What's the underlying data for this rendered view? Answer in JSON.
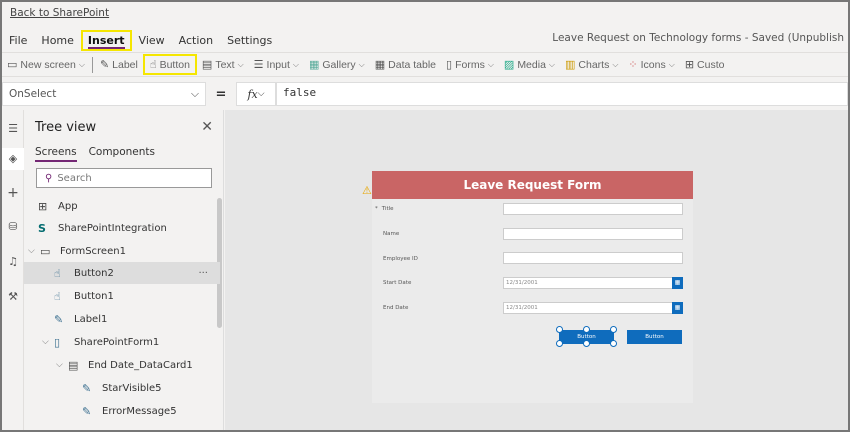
{
  "back_link": "Back to SharePoint",
  "menu": [
    "File",
    "Home",
    "Insert",
    "View",
    "Action",
    "Settings"
  ],
  "active_menu": "Insert",
  "app_title": "Leave Request on Technology forms - Saved (Unpublish",
  "toolbar": [
    {
      "label": "New screen",
      "icon": "new-screen-icon",
      "chevron": "⌵"
    },
    {
      "label": "Label",
      "icon": "label-icon"
    },
    {
      "label": "Button",
      "icon": "button-icon"
    },
    {
      "label": "Text",
      "icon": "text-icon",
      "chevron": "⌵"
    },
    {
      "label": "Input",
      "icon": "input-icon",
      "chevron": "⌵"
    },
    {
      "label": "Gallery",
      "icon": "gallery-icon",
      "chevron": "⌵"
    },
    {
      "label": "Data table",
      "icon": "data-table-icon"
    },
    {
      "label": "Forms",
      "icon": "forms-icon",
      "chevron": "⌵"
    },
    {
      "label": "Media",
      "icon": "media-icon",
      "chevron": "⌵"
    },
    {
      "label": "Charts",
      "icon": "charts-icon",
      "chevron": "⌵"
    },
    {
      "label": "Icons",
      "icon": "icons-icon",
      "chevron": "⌵"
    },
    {
      "label": "Custo",
      "icon": "custom-icon"
    }
  ],
  "formula": {
    "property": "OnSelect",
    "equals": "=",
    "fx": "fx",
    "value": "false"
  },
  "tree": {
    "title": "Tree view",
    "tabs": [
      "Screens",
      "Components"
    ],
    "search_placeholder": "Search",
    "nodes": [
      {
        "label": "App",
        "icon": "app-icon"
      },
      {
        "label": "SharePointIntegration",
        "icon": "sharepoint-icon"
      },
      {
        "label": "FormScreen1",
        "icon": "screen-icon"
      },
      {
        "label": "Button2",
        "icon": "button-icon",
        "selected": true
      },
      {
        "label": "Button1",
        "icon": "button-icon"
      },
      {
        "label": "Label1",
        "icon": "label-icon"
      },
      {
        "label": "SharePointForm1",
        "icon": "form-icon"
      },
      {
        "label": "End Date_DataCard1",
        "icon": "datacard-icon"
      },
      {
        "label": "StarVisible5",
        "icon": "label-icon"
      },
      {
        "label": "ErrorMessage5",
        "icon": "label-icon"
      }
    ]
  },
  "form": {
    "title": "Leave Request Form",
    "fields": [
      {
        "label": "Title",
        "required": "*",
        "value": ""
      },
      {
        "label": "Name",
        "value": ""
      },
      {
        "label": "Employee ID",
        "value": ""
      },
      {
        "label": "Start Date",
        "value": "12/31/2001"
      },
      {
        "label": "End Date",
        "value": "12/31/2001"
      }
    ],
    "buttons": [
      "Button",
      "Button"
    ]
  },
  "colors": {
    "header": "#c96565",
    "accent": "#742774",
    "button": "#0f6cbd",
    "highlight": "#f5e600"
  }
}
